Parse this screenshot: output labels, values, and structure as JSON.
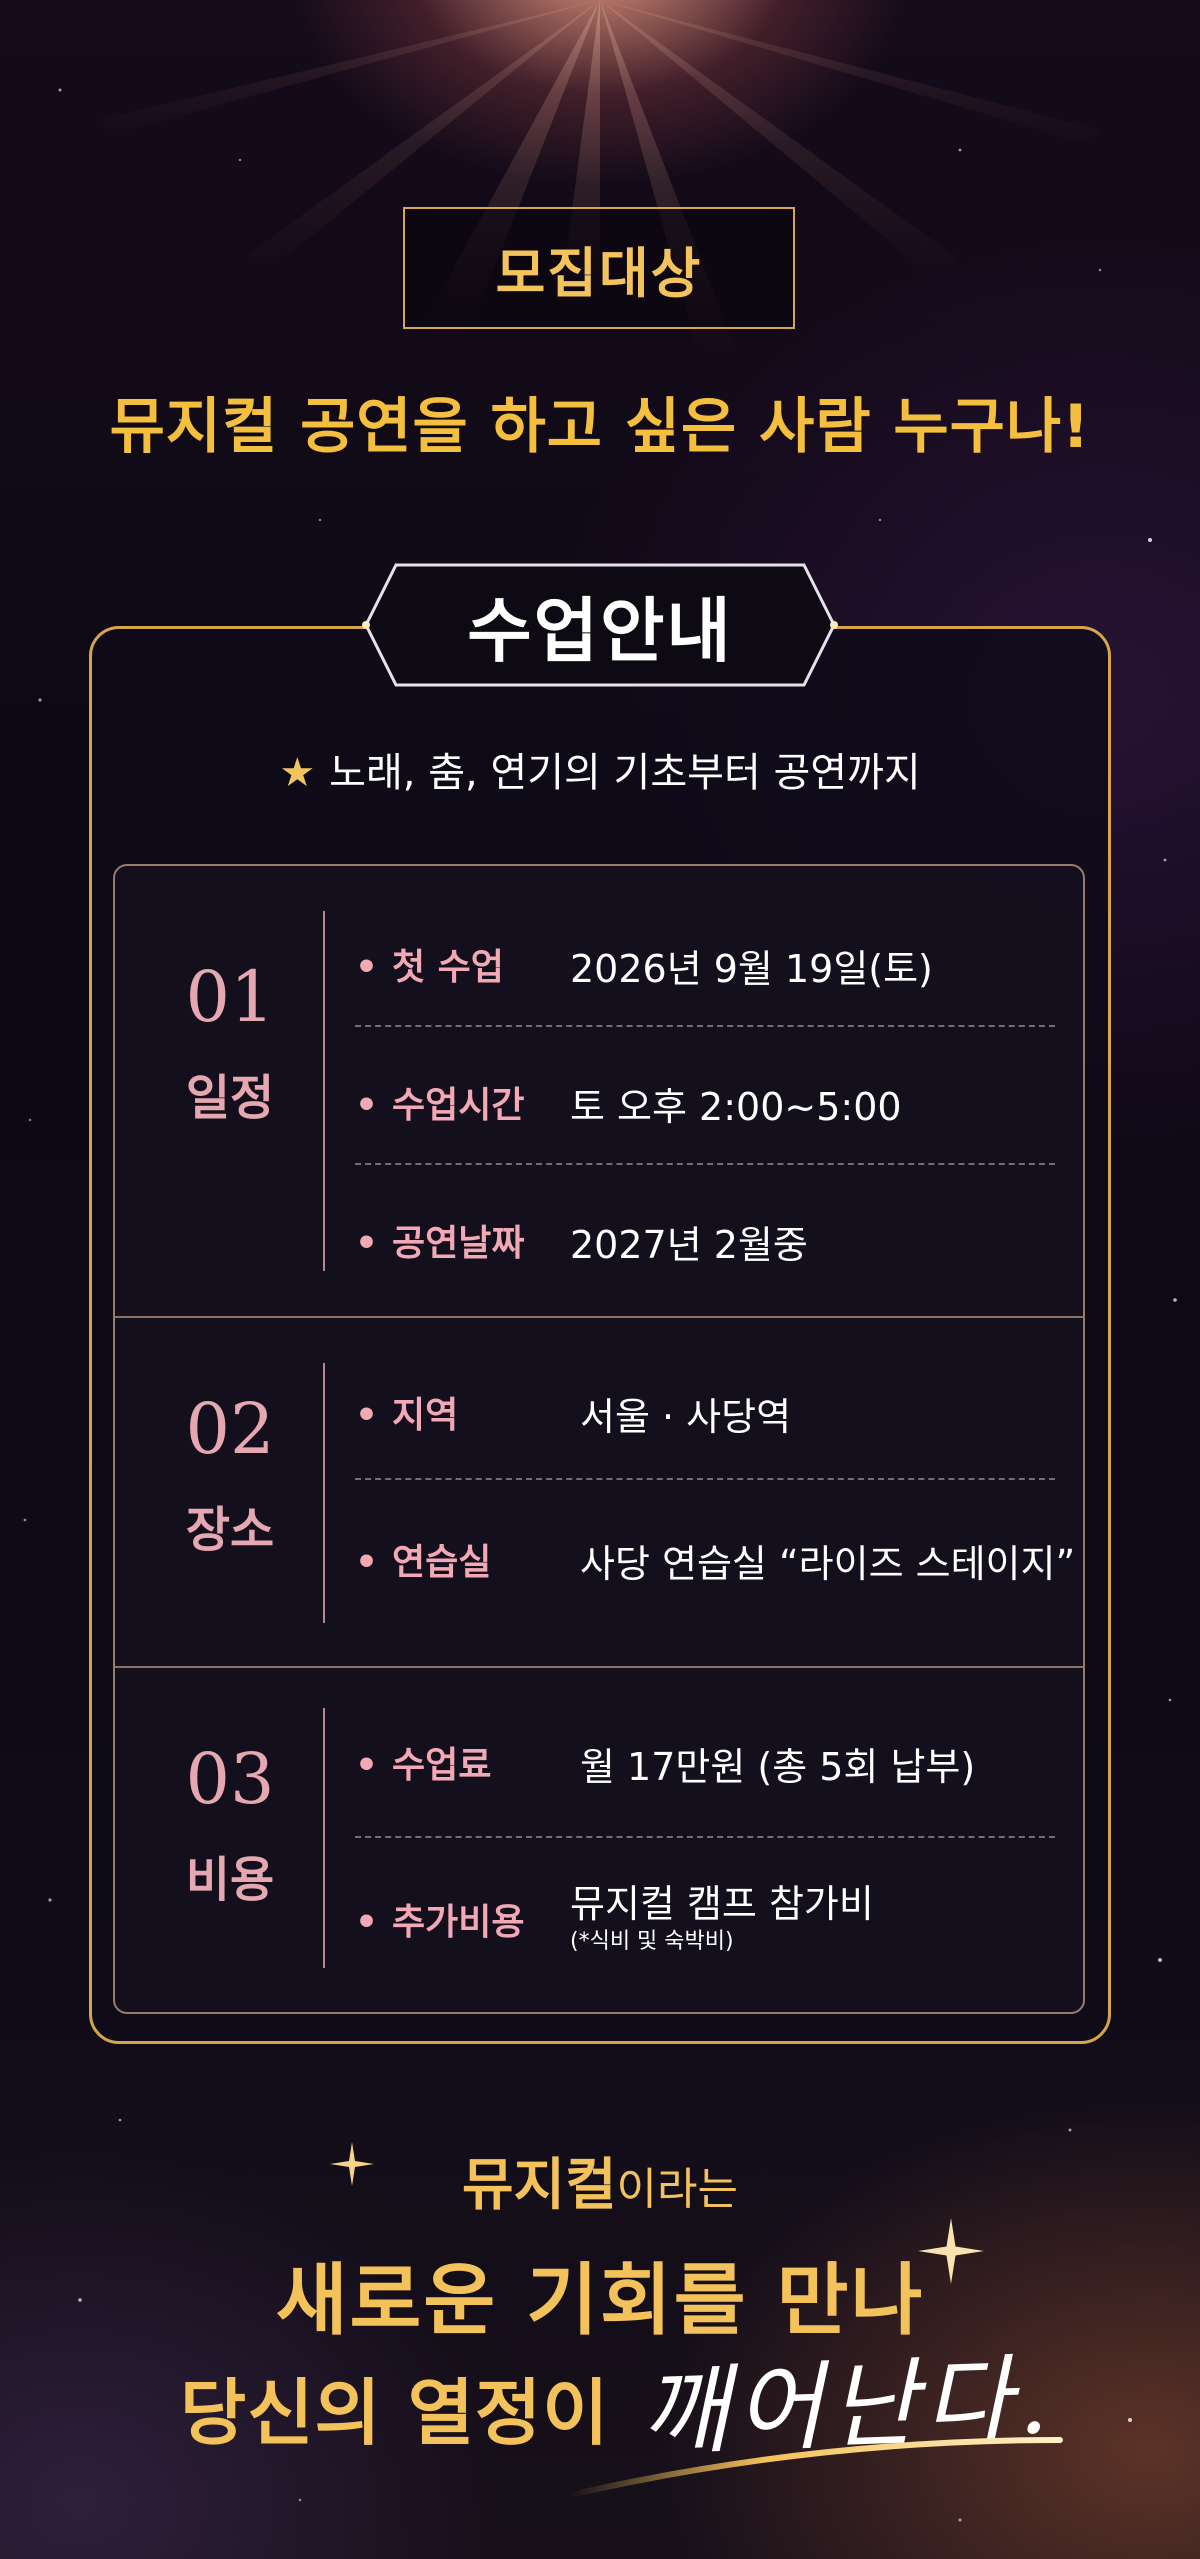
{
  "recruit": {
    "tag": "모집대상",
    "headline": "뮤지컬 공연을 하고 싶은 사람 누구나!"
  },
  "info": {
    "title": "수업안내",
    "subtitle_star": "★",
    "subtitle": "노래, 춤, 연기의 기초부터 공연까지",
    "sections": [
      {
        "number": "01",
        "title": "일정",
        "rows": [
          {
            "label": "첫 수업",
            "value": "2026년 9월 19일(토)"
          },
          {
            "label": "수업시간",
            "value": "토 오후 2:00~5:00"
          },
          {
            "label": "공연날짜",
            "value": "2027년 2월중"
          }
        ]
      },
      {
        "number": "02",
        "title": "장소",
        "rows": [
          {
            "label": "지역",
            "value": "서울 · 사당역"
          },
          {
            "label": "연습실",
            "value": "사당 연습실 “라이즈 스테이지”"
          }
        ]
      },
      {
        "number": "03",
        "title": "비용",
        "rows": [
          {
            "label": "수업료",
            "value": "월 17만원 (총 5회 납부)"
          },
          {
            "label": "추가비용",
            "value": "뮤지컬 캠프 참가비",
            "note": "(*식비 및 숙박비)"
          }
        ]
      }
    ]
  },
  "closing": {
    "line1_bold": "뮤지컬",
    "line1_rest": "이라는",
    "line2": "새로운 기회를 만나",
    "line3": "당신의 열정이",
    "script": "깨어난다."
  },
  "colors": {
    "gold": "#f4c25a",
    "pink": "#e6a8b0",
    "border": "#d6a54a"
  }
}
